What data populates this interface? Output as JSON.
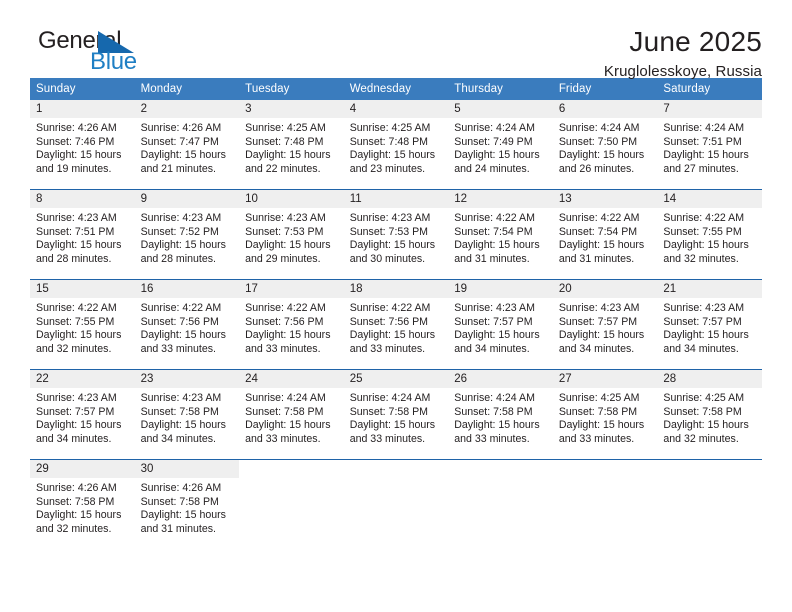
{
  "brand": {
    "name_part1": "General",
    "name_part2": "Blue",
    "flag_icon": "triangle-flag-icon"
  },
  "header": {
    "title": "June 2025",
    "subtitle": "Kruglolesskoye, Russia"
  },
  "colors": {
    "header_blue": "#3a7cbe",
    "rule_blue": "#1f63a8",
    "band_gray": "#efefef",
    "brand_blue": "#1f7fc4",
    "text": "#231f20"
  },
  "calendar": {
    "weekday_headers": [
      "Sunday",
      "Monday",
      "Tuesday",
      "Wednesday",
      "Thursday",
      "Friday",
      "Saturday"
    ],
    "weeks": [
      [
        {
          "day": "1",
          "sunrise": "Sunrise: 4:26 AM",
          "sunset": "Sunset: 7:46 PM",
          "daylight": "Daylight: 15 hours and 19 minutes."
        },
        {
          "day": "2",
          "sunrise": "Sunrise: 4:26 AM",
          "sunset": "Sunset: 7:47 PM",
          "daylight": "Daylight: 15 hours and 21 minutes."
        },
        {
          "day": "3",
          "sunrise": "Sunrise: 4:25 AM",
          "sunset": "Sunset: 7:48 PM",
          "daylight": "Daylight: 15 hours and 22 minutes."
        },
        {
          "day": "4",
          "sunrise": "Sunrise: 4:25 AM",
          "sunset": "Sunset: 7:48 PM",
          "daylight": "Daylight: 15 hours and 23 minutes."
        },
        {
          "day": "5",
          "sunrise": "Sunrise: 4:24 AM",
          "sunset": "Sunset: 7:49 PM",
          "daylight": "Daylight: 15 hours and 24 minutes."
        },
        {
          "day": "6",
          "sunrise": "Sunrise: 4:24 AM",
          "sunset": "Sunset: 7:50 PM",
          "daylight": "Daylight: 15 hours and 26 minutes."
        },
        {
          "day": "7",
          "sunrise": "Sunrise: 4:24 AM",
          "sunset": "Sunset: 7:51 PM",
          "daylight": "Daylight: 15 hours and 27 minutes."
        }
      ],
      [
        {
          "day": "8",
          "sunrise": "Sunrise: 4:23 AM",
          "sunset": "Sunset: 7:51 PM",
          "daylight": "Daylight: 15 hours and 28 minutes."
        },
        {
          "day": "9",
          "sunrise": "Sunrise: 4:23 AM",
          "sunset": "Sunset: 7:52 PM",
          "daylight": "Daylight: 15 hours and 28 minutes."
        },
        {
          "day": "10",
          "sunrise": "Sunrise: 4:23 AM",
          "sunset": "Sunset: 7:53 PM",
          "daylight": "Daylight: 15 hours and 29 minutes."
        },
        {
          "day": "11",
          "sunrise": "Sunrise: 4:23 AM",
          "sunset": "Sunset: 7:53 PM",
          "daylight": "Daylight: 15 hours and 30 minutes."
        },
        {
          "day": "12",
          "sunrise": "Sunrise: 4:22 AM",
          "sunset": "Sunset: 7:54 PM",
          "daylight": "Daylight: 15 hours and 31 minutes."
        },
        {
          "day": "13",
          "sunrise": "Sunrise: 4:22 AM",
          "sunset": "Sunset: 7:54 PM",
          "daylight": "Daylight: 15 hours and 31 minutes."
        },
        {
          "day": "14",
          "sunrise": "Sunrise: 4:22 AM",
          "sunset": "Sunset: 7:55 PM",
          "daylight": "Daylight: 15 hours and 32 minutes."
        }
      ],
      [
        {
          "day": "15",
          "sunrise": "Sunrise: 4:22 AM",
          "sunset": "Sunset: 7:55 PM",
          "daylight": "Daylight: 15 hours and 32 minutes."
        },
        {
          "day": "16",
          "sunrise": "Sunrise: 4:22 AM",
          "sunset": "Sunset: 7:56 PM",
          "daylight": "Daylight: 15 hours and 33 minutes."
        },
        {
          "day": "17",
          "sunrise": "Sunrise: 4:22 AM",
          "sunset": "Sunset: 7:56 PM",
          "daylight": "Daylight: 15 hours and 33 minutes."
        },
        {
          "day": "18",
          "sunrise": "Sunrise: 4:22 AM",
          "sunset": "Sunset: 7:56 PM",
          "daylight": "Daylight: 15 hours and 33 minutes."
        },
        {
          "day": "19",
          "sunrise": "Sunrise: 4:23 AM",
          "sunset": "Sunset: 7:57 PM",
          "daylight": "Daylight: 15 hours and 34 minutes."
        },
        {
          "day": "20",
          "sunrise": "Sunrise: 4:23 AM",
          "sunset": "Sunset: 7:57 PM",
          "daylight": "Daylight: 15 hours and 34 minutes."
        },
        {
          "day": "21",
          "sunrise": "Sunrise: 4:23 AM",
          "sunset": "Sunset: 7:57 PM",
          "daylight": "Daylight: 15 hours and 34 minutes."
        }
      ],
      [
        {
          "day": "22",
          "sunrise": "Sunrise: 4:23 AM",
          "sunset": "Sunset: 7:57 PM",
          "daylight": "Daylight: 15 hours and 34 minutes."
        },
        {
          "day": "23",
          "sunrise": "Sunrise: 4:23 AM",
          "sunset": "Sunset: 7:58 PM",
          "daylight": "Daylight: 15 hours and 34 minutes."
        },
        {
          "day": "24",
          "sunrise": "Sunrise: 4:24 AM",
          "sunset": "Sunset: 7:58 PM",
          "daylight": "Daylight: 15 hours and 33 minutes."
        },
        {
          "day": "25",
          "sunrise": "Sunrise: 4:24 AM",
          "sunset": "Sunset: 7:58 PM",
          "daylight": "Daylight: 15 hours and 33 minutes."
        },
        {
          "day": "26",
          "sunrise": "Sunrise: 4:24 AM",
          "sunset": "Sunset: 7:58 PM",
          "daylight": "Daylight: 15 hours and 33 minutes."
        },
        {
          "day": "27",
          "sunrise": "Sunrise: 4:25 AM",
          "sunset": "Sunset: 7:58 PM",
          "daylight": "Daylight: 15 hours and 33 minutes."
        },
        {
          "day": "28",
          "sunrise": "Sunrise: 4:25 AM",
          "sunset": "Sunset: 7:58 PM",
          "daylight": "Daylight: 15 hours and 32 minutes."
        }
      ],
      [
        {
          "day": "29",
          "sunrise": "Sunrise: 4:26 AM",
          "sunset": "Sunset: 7:58 PM",
          "daylight": "Daylight: 15 hours and 32 minutes."
        },
        {
          "day": "30",
          "sunrise": "Sunrise: 4:26 AM",
          "sunset": "Sunset: 7:58 PM",
          "daylight": "Daylight: 15 hours and 31 minutes."
        },
        {
          "day": "",
          "sunrise": "",
          "sunset": "",
          "daylight": ""
        },
        {
          "day": "",
          "sunrise": "",
          "sunset": "",
          "daylight": ""
        },
        {
          "day": "",
          "sunrise": "",
          "sunset": "",
          "daylight": ""
        },
        {
          "day": "",
          "sunrise": "",
          "sunset": "",
          "daylight": ""
        },
        {
          "day": "",
          "sunrise": "",
          "sunset": "",
          "daylight": ""
        }
      ]
    ]
  }
}
